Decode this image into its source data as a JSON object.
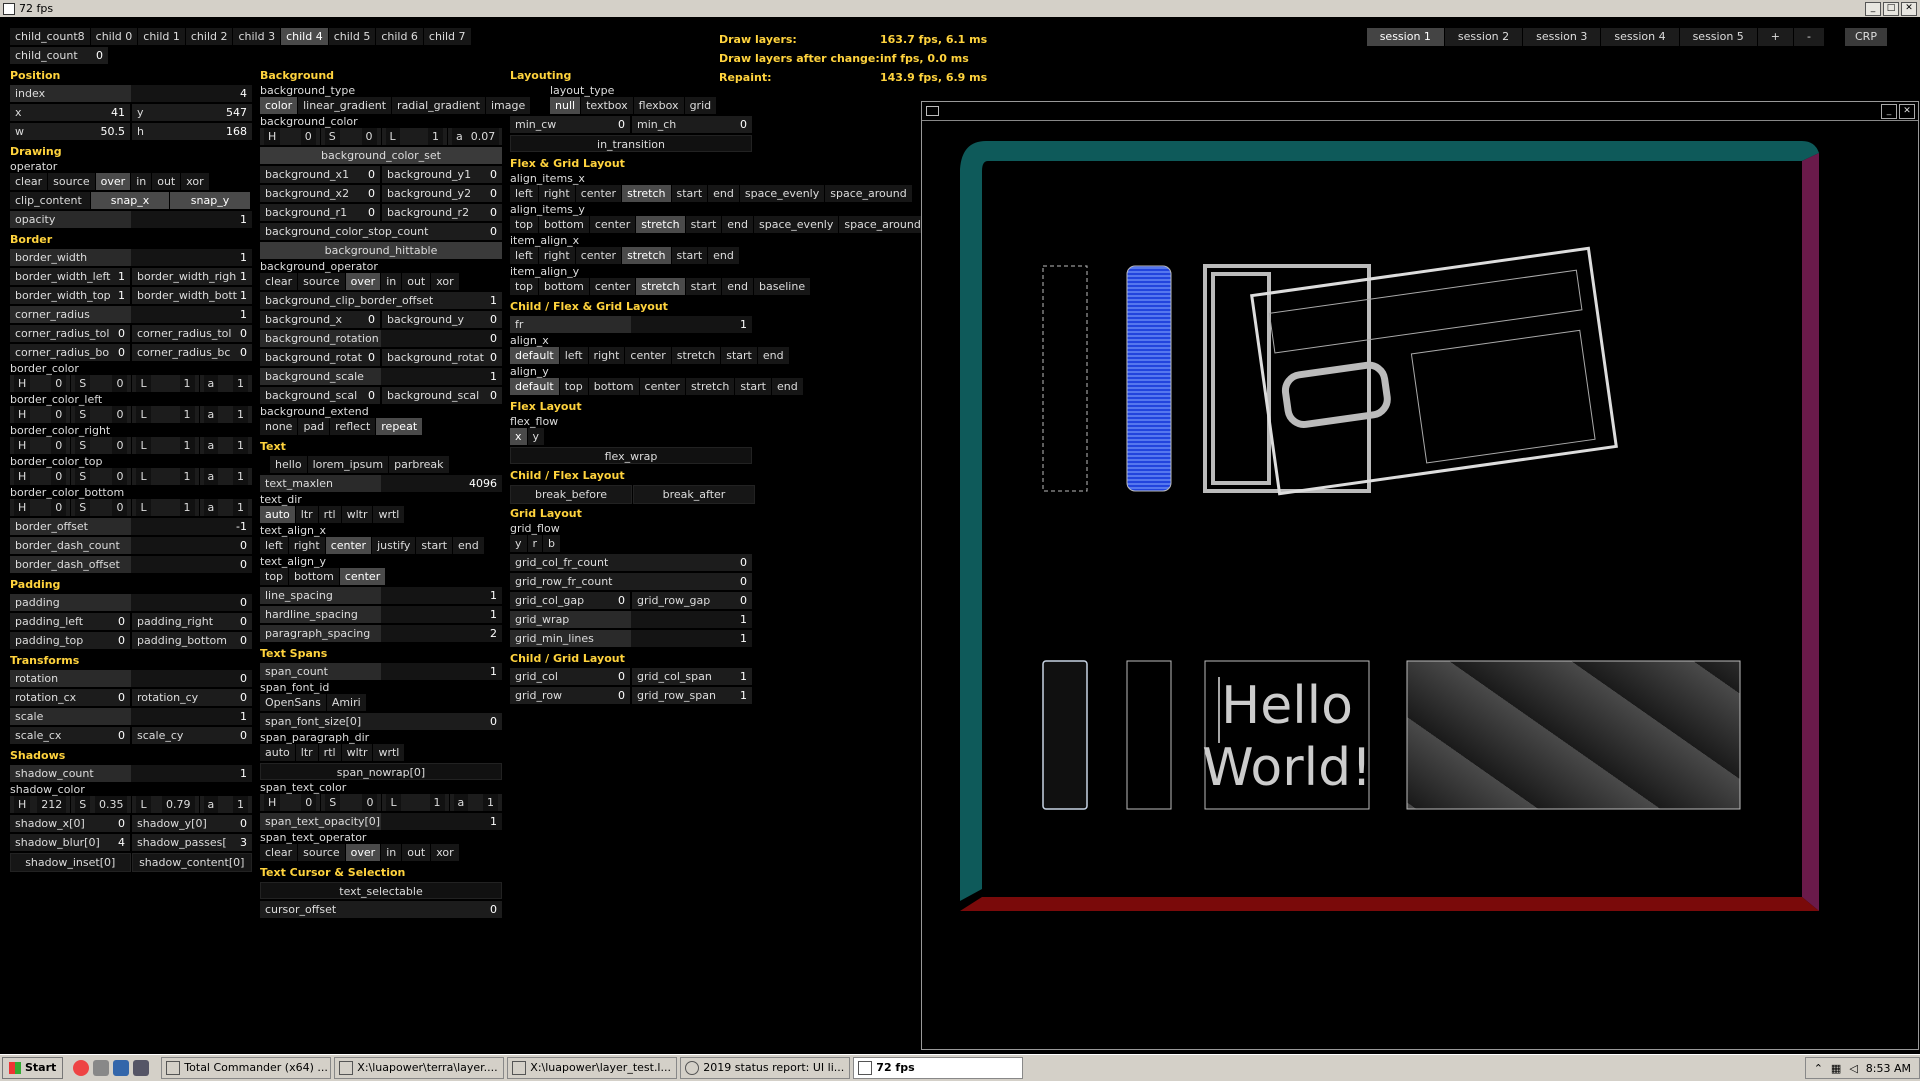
{
  "window": {
    "title": "72 fps"
  },
  "col1": {
    "child_count_label": "child_count",
    "child_count_value": "8",
    "children": [
      "child 0",
      "child 1",
      "child 2",
      "child 3",
      "child 4",
      "child 5",
      "child 6",
      "child 7"
    ],
    "child_count2_label": "child_count",
    "child_count2_value": "0",
    "position_hdr": "Position",
    "index_label": "index",
    "index_value": "4",
    "x_label": "x",
    "x_value": "41",
    "y_label": "y",
    "y_value": "547",
    "w_label": "w",
    "w_value": "50.5",
    "h_label": "h",
    "h_value": "168",
    "drawing_hdr": "Drawing",
    "operator_label": "operator",
    "operators": [
      "clear",
      "source",
      "over",
      "in",
      "out",
      "xor"
    ],
    "clip_content_label": "clip_content",
    "snap_x": "snap_x",
    "snap_y": "snap_y",
    "opacity_label": "opacity",
    "opacity_value": "1",
    "border_hdr": "Border",
    "border_width_label": "border_width",
    "border_width_value": "1",
    "bwl_label": "border_width_left",
    "bwl_value": "1",
    "bwr_label": "border_width_righ",
    "bwr_value": "1",
    "bwt_label": "border_width_top",
    "bwt_value": "1",
    "bwb_label": "border_width_bott",
    "bwb_value": "1",
    "corner_radius_label": "corner_radius",
    "corner_radius_value": "1",
    "crtl_label": "corner_radius_tol",
    "crtl_value": "0",
    "crtr_label": "corner_radius_tol",
    "crtr_value": "0",
    "crbl_label": "corner_radius_bo",
    "crbl_value": "0",
    "crbr_label": "corner_radius_bc",
    "crbr_value": "0",
    "border_colors": [
      {
        "label": "border_color",
        "H": "0",
        "S": "0",
        "L": "1",
        "a": "1"
      },
      {
        "label": "border_color_left",
        "H": "0",
        "S": "0",
        "L": "1",
        "a": "1"
      },
      {
        "label": "border_color_right",
        "H": "0",
        "S": "0",
        "L": "1",
        "a": "1"
      },
      {
        "label": "border_color_top",
        "H": "0",
        "S": "0",
        "L": "1",
        "a": "1"
      },
      {
        "label": "border_color_bottom",
        "H": "0",
        "S": "0",
        "L": "1",
        "a": "1"
      }
    ],
    "border_offset_label": "border_offset",
    "border_offset_value": "-1",
    "border_dash_count_label": "border_dash_count",
    "border_dash_count_value": "0",
    "border_dash_offset_label": "border_dash_offset",
    "border_dash_offset_value": "0",
    "padding_hdr": "Padding",
    "padding_label": "padding",
    "padding_value": "0",
    "pl_label": "padding_left",
    "pl_value": "0",
    "pr_label": "padding_right",
    "pr_value": "0",
    "pt_label": "padding_top",
    "pt_value": "0",
    "pb_label": "padding_bottom",
    "pb_value": "0",
    "transforms_hdr": "Transforms",
    "rotation_label": "rotation",
    "rotation_value": "0",
    "rcx_label": "rotation_cx",
    "rcx_value": "0",
    "rcy_label": "rotation_cy",
    "rcy_value": "0",
    "scale_label": "scale",
    "scale_value": "1",
    "scx_label": "scale_cx",
    "scx_value": "0",
    "scy_label": "scale_cy",
    "scy_value": "0",
    "shadows_hdr": "Shadows",
    "shadow_count_label": "shadow_count",
    "shadow_count_value": "1",
    "shadow_color_label": "shadow_color",
    "sc_H": "212",
    "sc_S": "0.35",
    "sc_L": "0.79",
    "sc_a": "1",
    "shx_label": "shadow_x[0]",
    "shx_value": "0",
    "shy_label": "shadow_y[0]",
    "shy_value": "0",
    "shb_label": "shadow_blur[0]",
    "shb_value": "4",
    "shp_label": "shadow_passes[",
    "shp_value": "3",
    "shadow_inset": "shadow_inset[0]",
    "shadow_content": "shadow_content[0]"
  },
  "col2": {
    "background_hdr": "Background",
    "bg_type_label": "background_type",
    "bg_types": [
      "color",
      "linear_gradient",
      "radial_gradient",
      "image"
    ],
    "bg_color_label": "background_color",
    "bg_H": "0",
    "bg_S": "0",
    "bg_L": "1",
    "bg_a": "0.07",
    "bg_color_set": "background_color_set",
    "bx1_label": "background_x1",
    "bx1_value": "0",
    "by1_label": "background_y1",
    "by1_value": "0",
    "bx2_label": "background_x2",
    "bx2_value": "0",
    "by2_label": "background_y2",
    "by2_value": "0",
    "br1_label": "background_r1",
    "br1_value": "0",
    "br2_label": "background_r2",
    "br2_value": "0",
    "bcsc_label": "background_color_stop_count",
    "bcsc_value": "0",
    "bg_hittable": "background_hittable",
    "bg_operator_label": "background_operator",
    "bg_operators": [
      "clear",
      "source",
      "over",
      "in",
      "out",
      "xor"
    ],
    "bcbo_label": "background_clip_border_offset",
    "bcbo_value": "1",
    "bgx_label": "background_x",
    "bgx_value": "0",
    "bgy_label": "background_y",
    "bgy_value": "0",
    "bgrot_label": "background_rotation",
    "bgrot_value": "0",
    "bgrx_label": "background_rotat",
    "bgrx_value": "0",
    "bgry_label": "background_rotat",
    "bgry_value": "0",
    "bgscale_label": "background_scale",
    "bgscale_value": "1",
    "bgsx_label": "background_scal",
    "bgsx_value": "0",
    "bgsy_label": "background_scal",
    "bgsy_value": "0",
    "bg_extend_label": "background_extend",
    "bg_extends": [
      "none",
      "pad",
      "reflect",
      "repeat"
    ],
    "text_hdr": "Text",
    "text_opts": [
      "hello",
      "lorem_ipsum",
      "parbreak"
    ],
    "text_maxlen_label": "text_maxlen",
    "text_maxlen_value": "4096",
    "text_dir_label": "text_dir",
    "text_dirs": [
      "auto",
      "ltr",
      "rtl",
      "wltr",
      "wrtl"
    ],
    "text_align_x_label": "text_align_x",
    "text_align_xs": [
      "left",
      "right",
      "center",
      "justify",
      "start",
      "end"
    ],
    "text_align_y_label": "text_align_y",
    "text_align_ys": [
      "top",
      "bottom",
      "center"
    ],
    "line_spacing_label": "line_spacing",
    "line_spacing_value": "1",
    "hardline_spacing_label": "hardline_spacing",
    "hardline_spacing_value": "1",
    "paragraph_spacing_label": "paragraph_spacing",
    "paragraph_spacing_value": "2",
    "spans_hdr": "Text Spans",
    "span_count_label": "span_count",
    "span_count_value": "1",
    "span_font_id_label": "span_font_id",
    "span_fonts": [
      "OpenSans",
      "Amiri"
    ],
    "span_font_size_label": "span_font_size[0]",
    "span_font_size_value": "0",
    "span_par_dir_label": "span_paragraph_dir",
    "span_par_dirs": [
      "auto",
      "ltr",
      "rtl",
      "wltr",
      "wrtl"
    ],
    "span_nowrap": "span_nowrap[0]",
    "span_text_color_label": "span_text_color",
    "stc_H": "0",
    "stc_S": "0",
    "stc_L": "1",
    "stc_a": "1",
    "span_text_opacity_label": "span_text_opacity[0]",
    "span_text_opacity_value": "1",
    "span_text_operator_label": "span_text_operator",
    "span_text_operators": [
      "clear",
      "source",
      "over",
      "in",
      "out",
      "xor"
    ],
    "cursor_hdr": "Text Cursor & Selection",
    "text_selectable": "text_selectable",
    "cursor_offset_label": "cursor_offset",
    "cursor_offset_value": "0"
  },
  "col3": {
    "layouting_hdr": "Layouting",
    "layout_type_label": "layout_type",
    "layout_types": [
      "null",
      "textbox",
      "flexbox",
      "grid"
    ],
    "min_cw_label": "min_cw",
    "min_cw_value": "0",
    "min_ch_label": "min_ch",
    "min_ch_value": "0",
    "in_transition": "in_transition",
    "flexgrid_hdr": "Flex & Grid Layout",
    "align_items_x_label": "align_items_x",
    "align_items_xs": [
      "left",
      "right",
      "center",
      "stretch",
      "start",
      "end",
      "space_evenly",
      "space_around"
    ],
    "align_items_y_label": "align_items_y",
    "align_items_ys": [
      "top",
      "bottom",
      "center",
      "stretch",
      "start",
      "end",
      "space_evenly",
      "space_around"
    ],
    "item_align_x_label": "item_align_x",
    "item_align_xs": [
      "left",
      "right",
      "center",
      "stretch",
      "start",
      "end"
    ],
    "item_align_y_label": "item_align_y",
    "item_align_ys": [
      "top",
      "bottom",
      "center",
      "stretch",
      "start",
      "end",
      "baseline"
    ],
    "child_flexgrid_hdr": "Child / Flex & Grid Layout",
    "fr_label": "fr",
    "fr_value": "1",
    "align_x_label": "align_x",
    "align_xs": [
      "default",
      "left",
      "right",
      "center",
      "stretch",
      "start",
      "end"
    ],
    "align_y_label": "align_y",
    "align_ys": [
      "default",
      "top",
      "bottom",
      "center",
      "stretch",
      "start",
      "end"
    ],
    "flex_hdr": "Flex Layout",
    "flex_flow_label": "flex_flow",
    "flex_flows": [
      "x",
      "y"
    ],
    "flex_wrap": "flex_wrap",
    "child_flex_hdr": "Child / Flex Layout",
    "break_before": "break_before",
    "break_after": "break_after",
    "grid_hdr": "Grid Layout",
    "grid_flow_label": "grid_flow",
    "grid_flows": [
      "y",
      "r",
      "b"
    ],
    "gcfc_label": "grid_col_fr_count",
    "gcfc_value": "0",
    "grfc_label": "grid_row_fr_count",
    "grfc_value": "0",
    "gcg_label": "grid_col_gap",
    "gcg_value": "0",
    "grg_label": "grid_row_gap",
    "grg_value": "0",
    "grid_wrap_label": "grid_wrap",
    "grid_wrap_value": "1",
    "grid_min_lines_label": "grid_min_lines",
    "grid_min_lines_value": "1",
    "child_grid_hdr": "Child / Grid Layout",
    "grid_col_label": "grid_col",
    "grid_col_value": "0",
    "grid_col_span_label": "grid_col_span",
    "grid_col_span_value": "1",
    "grid_row_label": "grid_row",
    "grid_row_value": "0",
    "grid_row_span_label": "grid_row_span",
    "grid_row_span_value": "1"
  },
  "stats": {
    "draw_layers_label": "Draw layers:",
    "draw_layers_value": "163.7 fps, 6.1 ms",
    "after_change_label": "Draw layers after change:",
    "after_change_value": "inf fps, 0.0 ms",
    "repaint_label": "Repaint:",
    "repaint_value": "143.9 fps, 6.9 ms"
  },
  "sessions": [
    "session 1",
    "session 2",
    "session 3",
    "session 4",
    "session 5",
    "+",
    "-"
  ],
  "crp": "CRP",
  "canvas": {
    "hello_line1": "Hello",
    "hello_line2": "World!"
  },
  "taskbar": {
    "start": "Start",
    "tasks": [
      "Total Commander (x64) ...",
      "X:\\luapower\\terra\\layer....",
      "X:\\luapower\\layer_test.l...",
      "2019 status report: UI li...",
      "72 fps"
    ],
    "clock": "8:53 AM"
  },
  "colors": {
    "accent_header": "#ffd33d",
    "teal_border": "#0e5a5a",
    "red_border": "#7a0a0a",
    "magenta_border": "#6a1a4a",
    "blue_stripes": "#2244dd"
  }
}
